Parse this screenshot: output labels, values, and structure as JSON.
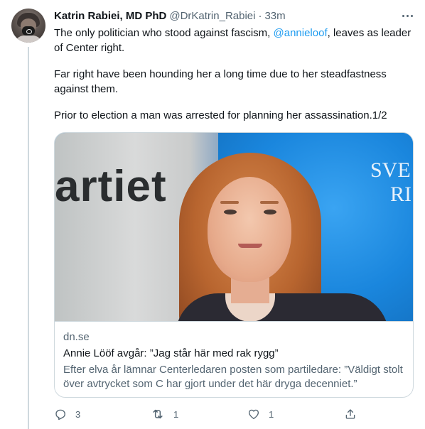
{
  "tweet": {
    "display_name": "Katrin Rabiei, MD PhD",
    "handle": "@DrKatrin_Rabiei",
    "separator": "·",
    "time": "33m",
    "text": {
      "line1_before": "The only politician who stood against fascism, ",
      "mention": "@annieloof",
      "line1_after": ", leaves as leader",
      "line2": "of Center right.",
      "line3": "Far right have been hounding her a long time due to her steadfastness",
      "line4": "against them.",
      "line5": "Prior to election a man was arrested for planning her assassination.1/2"
    }
  },
  "card": {
    "image_word_left": "artiet",
    "image_word_right_1": "SVE",
    "image_word_right_2": "RI",
    "domain": "dn.se",
    "title": "Annie Lööf avgår: ”Jag står här med rak rygg”",
    "description": "Efter elva år lämnar Centerledaren posten som partiledare: ”Väldigt stolt över avtrycket som C har gjort under det här dryga decenniet.”"
  },
  "actions": {
    "reply": {
      "icon": "reply-icon",
      "count": "3"
    },
    "retweet": {
      "icon": "retweet-icon",
      "count": "1"
    },
    "like": {
      "icon": "heart-icon",
      "count": "1"
    },
    "share": {
      "icon": "share-icon"
    }
  },
  "colors": {
    "text": "#0f1419",
    "secondary": "#536471",
    "link": "#1d9bf0",
    "border": "#cfd9de"
  }
}
